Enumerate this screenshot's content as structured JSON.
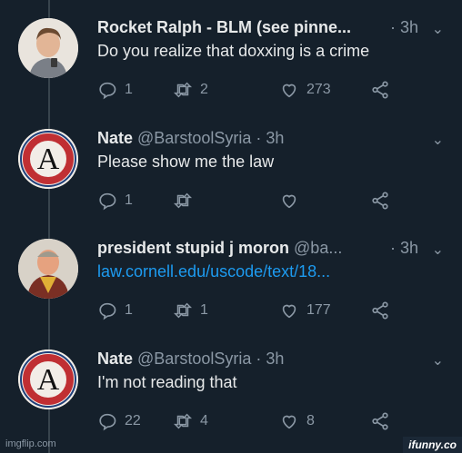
{
  "tweets": [
    {
      "name": "Rocket Ralph - BLM (see pinne...",
      "handle": "",
      "time": "· 3h",
      "text": "Do you realize that doxxing is a crime",
      "replies": "1",
      "retweets": "2",
      "likes": "273"
    },
    {
      "name": "Nate",
      "handle": "@BarstoolSyria",
      "time": "· 3h",
      "text": "Please show me the law",
      "replies": "1",
      "retweets": "",
      "likes": ""
    },
    {
      "name": "president stupid j moron",
      "handle": "@ba...",
      "time": "· 3h",
      "text": "law.cornell.edu/uscode/text/18...",
      "replies": "1",
      "retweets": "1",
      "likes": "177"
    },
    {
      "name": "Nate",
      "handle": "@BarstoolSyria",
      "time": "· 3h",
      "text": "I'm not reading that",
      "replies": "22",
      "retweets": "4",
      "likes": "8"
    }
  ],
  "footer": {
    "left": "imgflip.com",
    "right": "ifunny.co"
  },
  "colors": {
    "background": "#15202b",
    "text": "#e7e9ea",
    "muted": "#8b98a5",
    "link": "#1d9bf0"
  },
  "icons": [
    "reply-icon",
    "retweet-icon",
    "like-icon",
    "share-icon",
    "chevron-down-icon"
  ]
}
